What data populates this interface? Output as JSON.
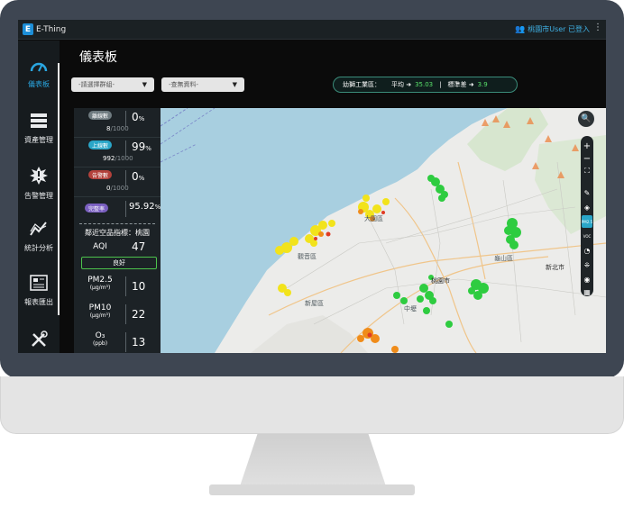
{
  "app": {
    "name": "E-Thing",
    "logo_letter": "E",
    "user_text": "桃園市User 已登入",
    "menu_icon": "⋮"
  },
  "sidebar": {
    "items": [
      {
        "label": "儀表板",
        "icon": "gauge-icon",
        "glyph": "◜",
        "active": true
      },
      {
        "label": "資產管理",
        "icon": "server-icon",
        "glyph": "☰",
        "active": false
      },
      {
        "label": "告警管理",
        "icon": "alert-icon",
        "glyph": "✹",
        "active": false
      },
      {
        "label": "統計分析",
        "icon": "chart-icon",
        "glyph": "⩘",
        "active": false
      },
      {
        "label": "報表匯出",
        "icon": "report-icon",
        "glyph": "▤",
        "active": false
      },
      {
        "label": "",
        "icon": "tools-icon",
        "glyph": "⚒",
        "active": false
      }
    ]
  },
  "main": {
    "title": "儀表板",
    "filter_group": {
      "value": "-請選擇群組-",
      "caret": "▼"
    },
    "filter_data": {
      "value": "-查無資料-",
      "caret": "▼"
    },
    "stats": {
      "label": "幼獅工業區：",
      "avg_label": "平均 ➜",
      "avg_value": "35.03",
      "sep": "|",
      "std_label": "標準差 ➜",
      "std_value": "3.9"
    }
  },
  "panel": {
    "status": [
      {
        "label": "離線數",
        "color": "#6f7b80",
        "percent": "0",
        "unit": "%",
        "count": "8",
        "total": "/1000"
      },
      {
        "label": "上線數",
        "color": "#2aa6c8",
        "percent": "99",
        "unit": "%",
        "count": "992",
        "total": "/1000"
      },
      {
        "label": "告警數",
        "color": "#b3413b",
        "percent": "0",
        "unit": "%",
        "count": "0",
        "total": "/1000"
      },
      {
        "label": "完整率",
        "color": "#7a5fc0",
        "percent": "95.92",
        "unit": "%",
        "count": "",
        "total": ""
      }
    ],
    "aqi_title": "鄰近空品指標：桃園",
    "aqi": {
      "label": "AQI",
      "value": "47",
      "status": "良好"
    },
    "pm25": {
      "label": "PM2.5",
      "unit": "(μg/m³)",
      "value": "10"
    },
    "pm10": {
      "label": "PM10",
      "unit": "(μg/m³)",
      "value": "22"
    },
    "o3": {
      "label": "O₃",
      "unit": "(ppb)",
      "value": "13"
    }
  },
  "map": {
    "tools": [
      "🔍",
      "+",
      "−",
      "⛶",
      "✎",
      "◈",
      "PM2.5",
      "VOC",
      "◔",
      "⁜",
      "◉",
      "▦"
    ],
    "place_labels": [
      "桃園市",
      "新北市",
      "大園區",
      "中壢",
      "觀音區",
      "新屋區",
      "龜山區"
    ],
    "colors": {
      "sea": "#a8cfe0",
      "land": "#ececea",
      "good": "#2ecc40",
      "moderate": "#f2e31b",
      "high": "#f08c1a",
      "very_high": "#e03b24"
    }
  }
}
